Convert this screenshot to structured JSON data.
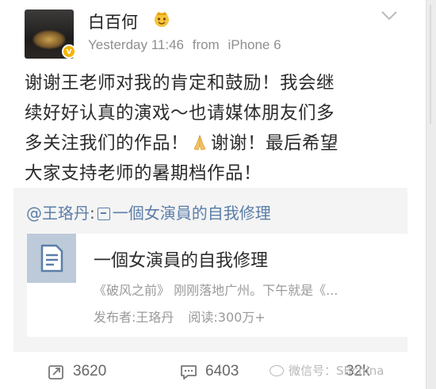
{
  "post": {
    "username": "白百何",
    "badge_icon": "crown-emoji-icon",
    "timestamp": "Yesterday 11:46",
    "source_prefix": "from",
    "source": "iPhone 6",
    "content_lines": [
      "谢谢王老师对我的肯定和鼓励！我会继",
      "续好好认真的演戏～也请媒体朋友们多",
      "多关注我们的作品！",
      "谢谢！最后希望",
      "大家支持老师的暑期档作品！"
    ]
  },
  "repost": {
    "mention": "@王珞丹",
    "colon": ":",
    "text": "一個女演員的自我修理",
    "card": {
      "title": "一個女演員的自我修理",
      "summary": "《破风之前》 刚刚落地广州。下午就是《...",
      "publisher": "发布者:王珞丹",
      "reads": "阅读:300万+"
    }
  },
  "actions": {
    "repost_count": "3620",
    "comment_count": "6403",
    "like_count": "32k"
  },
  "watermark": {
    "text": "微信号：SBchina"
  },
  "colors": {
    "link": "#5b7ea8",
    "meta": "#8f8f8f",
    "repost_bg": "#f4f4f4",
    "verified": "#f7b500"
  }
}
